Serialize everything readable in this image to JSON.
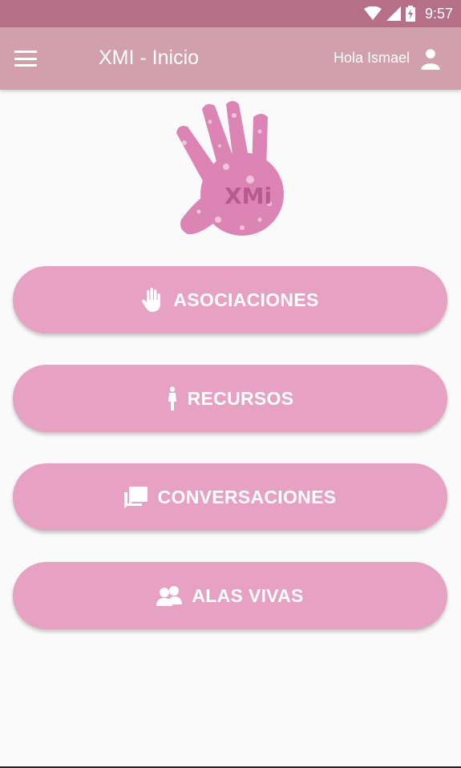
{
  "status_bar": {
    "time": "9:57",
    "icons": [
      "wifi-icon",
      "signal-icon",
      "battery-charging-icon"
    ]
  },
  "app_bar": {
    "menu_icon": "hamburger-menu-icon",
    "title": "XMI - Inicio",
    "greeting": "Hola Ismael",
    "account_icon": "account-icon"
  },
  "logo": {
    "text": "XMi"
  },
  "menu": [
    {
      "label": "ASOCIACIONES",
      "icon": "hand-icon"
    },
    {
      "label": "RECURSOS",
      "icon": "woman-icon"
    },
    {
      "label": "CONVERSACIONES",
      "icon": "chat-icon"
    },
    {
      "label": "ALAS VIVAS",
      "icon": "group-icon"
    }
  ],
  "colors": {
    "status_bar": "#b57088",
    "app_bar": "#d29fad",
    "button": "#e6a1c3",
    "logo": "#dc85b5",
    "background": "#fafafa"
  }
}
